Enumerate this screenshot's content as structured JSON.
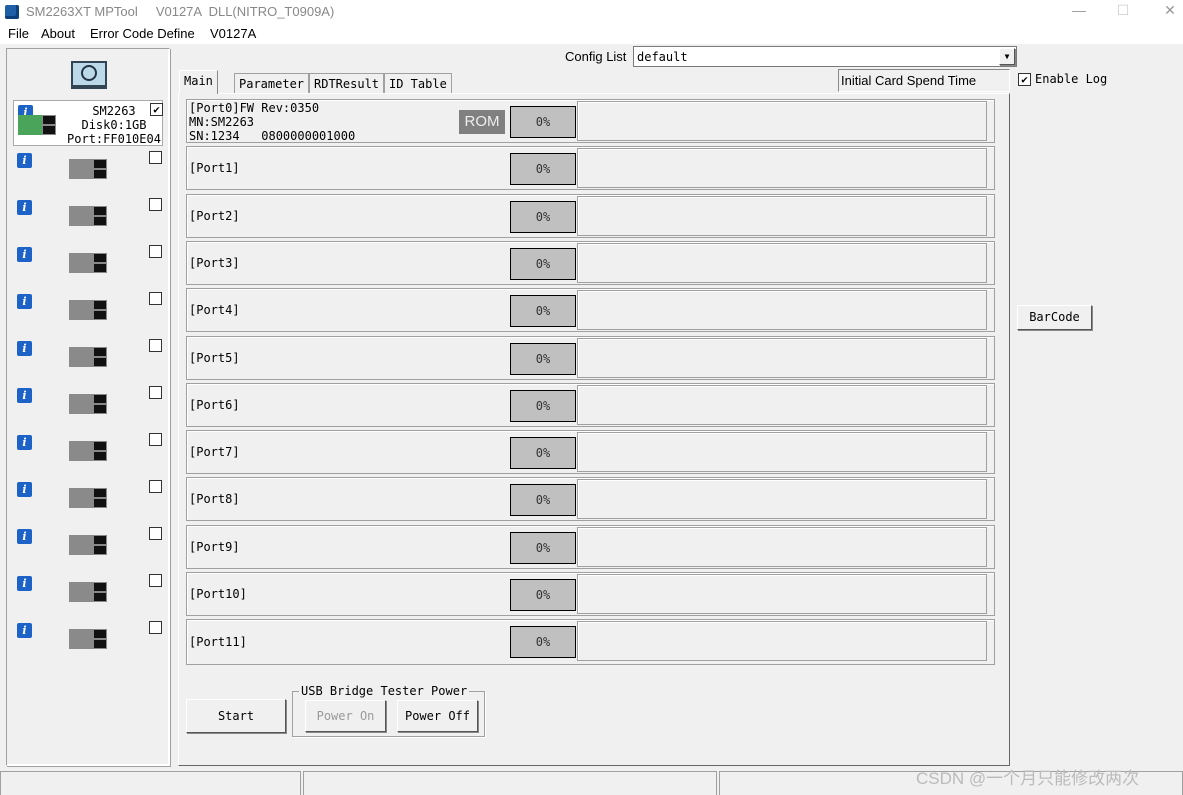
{
  "window": {
    "title": "SM2263XT MPTool     V0127A  DLL(NITRO_T0909A)"
  },
  "menu": [
    "File",
    "About",
    "Error Code Define",
    "V0127A"
  ],
  "config": {
    "label": "Config List",
    "value": "default"
  },
  "spend_time": "Initial Card Spend Time",
  "enable_log": {
    "label": "Enable Log",
    "checked": true
  },
  "barcode": "BarCode",
  "tabs": [
    "Main",
    "Parameter",
    "RDTResult",
    "ID Table"
  ],
  "slots": [
    {
      "lines": [
        "SM2263",
        "Disk0:1GB",
        "Port:FF010E04"
      ],
      "checked": true,
      "active": true
    },
    {
      "checked": false
    },
    {
      "checked": false
    },
    {
      "checked": false
    },
    {
      "checked": false
    },
    {
      "checked": false
    },
    {
      "checked": false
    },
    {
      "checked": false
    },
    {
      "checked": false
    },
    {
      "checked": false
    },
    {
      "checked": false
    },
    {
      "checked": false
    }
  ],
  "ports": [
    {
      "label": "[Port0]FW Rev:0350\nMN:SM2263\nSN:1234   0800000001000",
      "badge": "ROM",
      "percent": "0%",
      "progress": 0
    },
    {
      "label": "[Port1]",
      "percent": "0%",
      "progress": 0
    },
    {
      "label": "[Port2]",
      "percent": "0%",
      "progress": 0
    },
    {
      "label": "[Port3]",
      "percent": "0%",
      "progress": 0
    },
    {
      "label": "[Port4]",
      "percent": "0%",
      "progress": 0
    },
    {
      "label": "[Port5]",
      "percent": "0%",
      "progress": 0
    },
    {
      "label": "[Port6]",
      "percent": "0%",
      "progress": 0
    },
    {
      "label": "[Port7]",
      "percent": "0%",
      "progress": 0
    },
    {
      "label": "[Port8]",
      "percent": "0%",
      "progress": 0
    },
    {
      "label": "[Port9]",
      "percent": "0%",
      "progress": 0
    },
    {
      "label": "[Port10]",
      "percent": "0%",
      "progress": 0
    },
    {
      "label": "[Port11]",
      "percent": "0%",
      "progress": 0
    }
  ],
  "start": "Start",
  "power_group": {
    "title": "USB Bridge Tester Power",
    "on": "Power On",
    "off": "Power Off"
  },
  "watermark": "CSDN @一个月只能修改两次"
}
